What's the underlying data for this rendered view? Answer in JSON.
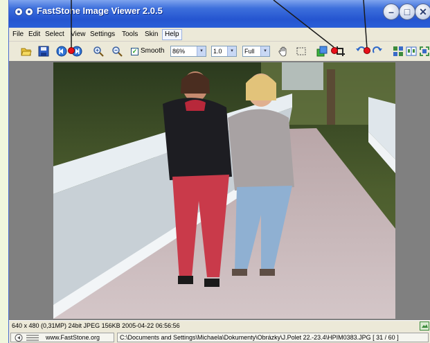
{
  "window": {
    "title": "FastStone Image Viewer 2.0.5",
    "minimize_glyph": "–",
    "maximize_glyph": "□",
    "close_glyph": "✕"
  },
  "menu": [
    "File",
    "Edit",
    "Select",
    "View",
    "Settings",
    "Tools",
    "Skin",
    "Help"
  ],
  "toolbar": {
    "smooth_label": "Smooth",
    "smooth_checked": "✓",
    "zoom_value": "86%",
    "ratio_value": "1.0",
    "fit_value": "Full",
    "dropdown_arrow": "▾"
  },
  "status": {
    "image_info": "640 x 480 (0,31MP)  24bit JPEG  156KB  2005-04-22 06:56:56",
    "website": "www.FastStone.org",
    "file_path": "C:\\Documents and Settings\\Michaela\\Dokumenty\\Obrázky\\J.Polet 22.-23.4\\HPIM0383.JPG [ 31 / 60 ]"
  },
  "icons": {
    "open": "folder-open-icon",
    "save": "floppy-disk-icon",
    "prev": "previous-image-icon",
    "next": "next-image-icon",
    "zoom_in": "zoom-in-icon",
    "zoom_out": "zoom-out-icon",
    "hand": "hand-pan-icon",
    "select": "selection-rectangle-icon",
    "resize": "resize-image-icon",
    "crop": "crop-icon",
    "rotate_left": "rotate-left-icon",
    "rotate_right": "rotate-right-icon",
    "thumbnails": "thumbnails-icon",
    "compare": "compare-icon",
    "fullscreen": "fullscreen-icon"
  },
  "colors": {
    "title_bar": "#2555d0",
    "annotation": "#e8101a",
    "page_background": "#eff6dd"
  }
}
